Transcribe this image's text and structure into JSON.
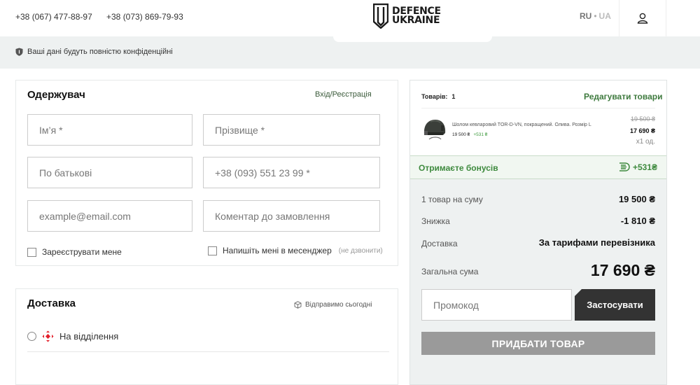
{
  "header": {
    "phone_1": "+38 (067) 477-88-97",
    "phone_2": "+38 (073) 869-79-93",
    "logo_line_1": "DEFENCE",
    "logo_line_2": "UKRAINE",
    "lang_active": "RU",
    "lang_separator": "•",
    "lang_other": "UA",
    "user_icon": "user-icon"
  },
  "privacy": {
    "icon": "shield-icon",
    "text": "Ваші дані будуть повністю конфіденційні"
  },
  "recipient": {
    "title": "Одержувач",
    "login_link": "Вхід/Реєстрація",
    "fields": {
      "first_name": "Ім’я *",
      "last_name": "Прізвище *",
      "patronymic": "По батькові",
      "phone": "+38 (093) 551 23 99 *",
      "email": "example@email.com",
      "comment": "Коментар до замовлення"
    },
    "register_label": "Зареєструвати мене",
    "messenger_label": "Напишіть мені в месенджер",
    "messenger_note": "(не дзвонити)"
  },
  "delivery": {
    "title": "Доставка",
    "ship_today": "Відправимо сьогодні",
    "branch_option": "На відділення"
  },
  "summary": {
    "items_label": "Товарів:",
    "items_count": "1",
    "edit_link": "Редагувати товари",
    "product": {
      "name": "Шолом кевларовий TOR-D-VN, покращений. Олива. Розмір L",
      "price": "19 500 ₴",
      "bonus": "+531 ₴",
      "old_price": "19 500 ₴",
      "new_price": "17 690 ₴",
      "qty": "x1 од."
    },
    "bonus_label": "Отримаєте бонусів",
    "bonus_value": "+531₴",
    "rows": {
      "subtotal_label": "1 товар на суму",
      "subtotal_value": "19 500 ₴",
      "discount_label": "Знижка",
      "discount_value": "-1 810 ₴",
      "shipping_label": "Доставка",
      "shipping_value": "За тарифами перевізника"
    },
    "total_label": "Загальна сума",
    "total_value": "17 690 ₴",
    "promo_placeholder": "Промокод",
    "promo_button": "Застосувати",
    "buy_button": "ПРИДБАТИ ТОВАР"
  },
  "colors": {
    "accent_green": "#3e8a3e",
    "panel_bg": "#eef1f1",
    "dark_button": "#333333",
    "disabled_button": "#9a9a9a",
    "nova_poshta_red": "#e3202b"
  }
}
